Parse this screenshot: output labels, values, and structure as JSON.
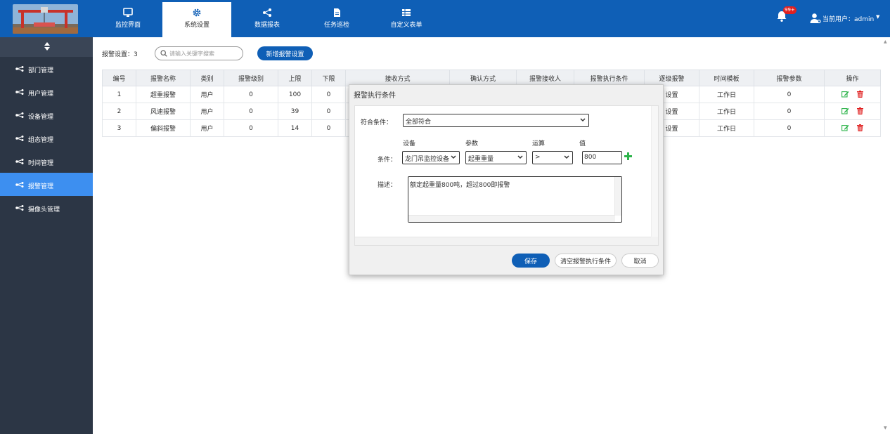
{
  "colors": {
    "primary": "#0f5fb6",
    "sidebar": "#2c3645",
    "sidebar_active": "#3d8ff0",
    "link": "#2d7fe0",
    "edit": "#2cb34a",
    "delete": "#e02020"
  },
  "nav": {
    "tabs": [
      {
        "label": "监控界面",
        "icon": "monitor-icon"
      },
      {
        "label": "系统设置",
        "icon": "gear-icon"
      },
      {
        "label": "数据报表",
        "icon": "share-icon"
      },
      {
        "label": "任务巡检",
        "icon": "document-icon"
      },
      {
        "label": "自定义表单",
        "icon": "form-icon"
      }
    ],
    "active_index": 1,
    "notification_count": "99+",
    "user_label": "当前用户：admin"
  },
  "sidebar": {
    "items": [
      {
        "label": "部门管理"
      },
      {
        "label": "用户管理"
      },
      {
        "label": "设备管理"
      },
      {
        "label": "组态管理"
      },
      {
        "label": "时间管理"
      },
      {
        "label": "报警管理"
      },
      {
        "label": "摄像头管理"
      }
    ],
    "active_index": 5
  },
  "toolbar": {
    "count_label": "报警设置：3",
    "search_placeholder": "请输入关键字搜索",
    "add_button": "新增报警设置"
  },
  "table": {
    "headers": [
      "编号",
      "报警名称",
      "类别",
      "报警级别",
      "上限",
      "下限",
      "接收方式",
      "确认方式",
      "报警接收人",
      "报警执行条件",
      "逐级报警",
      "时间模板",
      "报警参数",
      "操作"
    ],
    "rows": [
      {
        "id": "1",
        "name": "超重报警",
        "category": "用户",
        "level": "0",
        "upper": "100",
        "lower": "0",
        "escalate": "设置",
        "template": "工作日",
        "params": "0"
      },
      {
        "id": "2",
        "name": "风速报警",
        "category": "用户",
        "level": "0",
        "upper": "39",
        "lower": "0",
        "escalate": "设置",
        "template": "工作日",
        "params": "0"
      },
      {
        "id": "3",
        "name": "偏斜报警",
        "category": "用户",
        "level": "0",
        "upper": "14",
        "lower": "0",
        "escalate": "设置",
        "template": "工作日",
        "params": "0"
      }
    ]
  },
  "modal": {
    "title": "报警执行条件",
    "match_label": "符合条件：",
    "match_value": "全部符合",
    "col_device": "设备",
    "col_param": "参数",
    "col_op": "运算",
    "col_value": "值",
    "condition_label": "条件：",
    "device_value": "龙门吊监控设备",
    "param_value": "起重重量",
    "op_value": ">",
    "value_value": "800",
    "desc_label": "描述：",
    "desc_value": "额定起重量800吨，超过800即报警",
    "save": "保存",
    "clear": "清空报警执行条件",
    "cancel": "取消"
  }
}
